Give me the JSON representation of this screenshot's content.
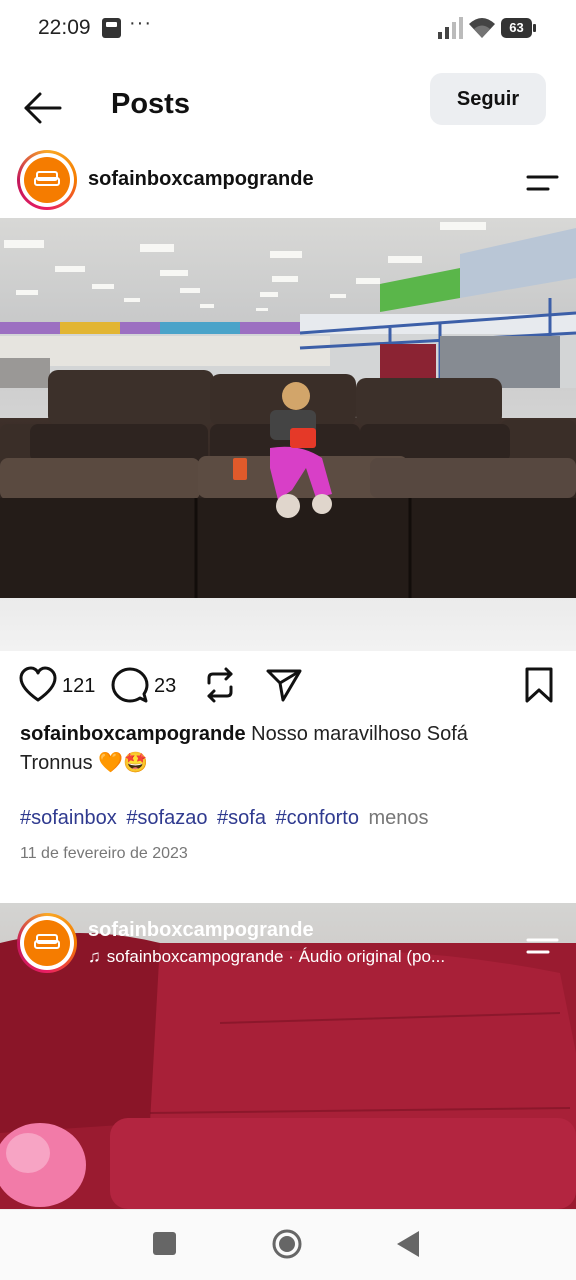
{
  "status_bar": {
    "time": "22:09",
    "dots": "···",
    "battery": "63"
  },
  "header": {
    "title": "Posts",
    "follow_label": "Seguir"
  },
  "post": {
    "username": "sofainboxcampogrande",
    "likes": "121",
    "comments": "23",
    "caption_user": "sofainboxcampogrande",
    "caption_text": " Nosso maravilhoso Sofá Tronnus 🧡🤩",
    "hashtags": [
      "#sofainbox",
      "#sofazao",
      "#sofa",
      "#conforto"
    ],
    "less_label": "menos",
    "date": "11 de fevereiro de 2023"
  },
  "next_post": {
    "username": "sofainboxcampogrande",
    "audio": "sofainboxcampogrande · Áudio original (po..."
  },
  "colors": {
    "hashtag": "#2f3a8f",
    "brand_orange": "#f57c00",
    "follow_bg": "#eceef1"
  },
  "icons": {
    "back": "arrow-left-icon",
    "menu": "menu-lines-icon",
    "like": "heart-icon",
    "comment": "comment-bubble-icon",
    "repost": "repost-icon",
    "share": "send-icon",
    "save": "bookmark-icon"
  }
}
